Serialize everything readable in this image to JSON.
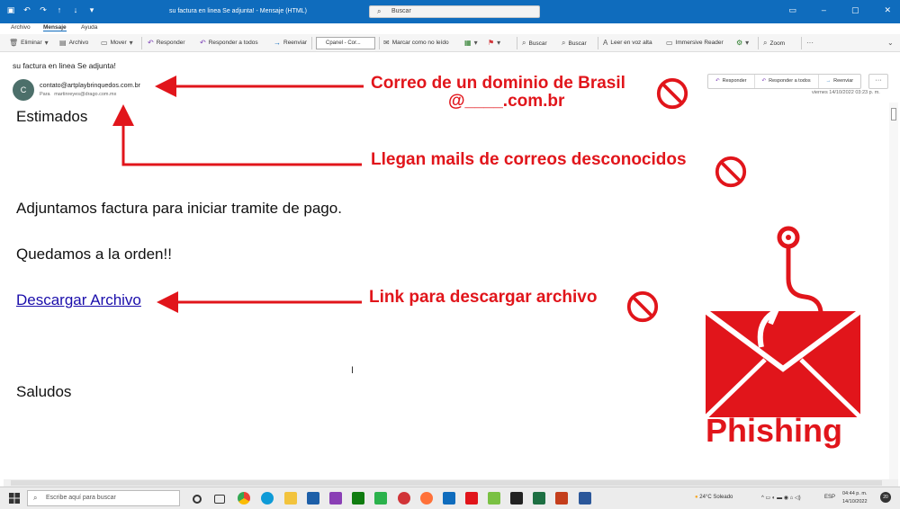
{
  "window": {
    "title": "su factura en linea Se adjunta! - Mensaje (HTML)",
    "search_placeholder": "Buscar"
  },
  "menu": {
    "items": [
      "Archivo",
      "Mensaje",
      "Ayuda"
    ],
    "active": "Mensaje"
  },
  "ribbon": {
    "eliminar": "Eliminar",
    "archivo": "Archivo",
    "mover": "Mover",
    "responder": "Responder",
    "responder_todos": "Responder a todos",
    "reenviar": "Reenviar",
    "cpanel": "Cpanel - Cor...",
    "marcar": "Marcar como no leído",
    "buscar1": "Buscar",
    "buscar2": "Buscar",
    "leer": "Leer en voz alta",
    "immersive": "Immersive Reader",
    "zoom": "Zoom"
  },
  "message": {
    "subject": "su factura en linea Se adjunta!",
    "avatar_initial": "C",
    "from": "contato@artplaybrinquedos.com.br",
    "to_label": "Para",
    "to": "martinreyes@drago.com.mx",
    "date": "viernes 14/10/2022 03:23 p. m.",
    "actions": {
      "responder": "Responder",
      "responder_todos": "Responder a todos",
      "reenviar": "Reenviar",
      "more": "···"
    },
    "body": {
      "greeting": "Estimados",
      "line1": "Adjuntamos factura para iniciar tramite de pago.",
      "line2": "Quedamos a la orden!!",
      "link": "Descargar Archivo",
      "closing": "Saludos"
    }
  },
  "annotations": {
    "a1_line1": "Correo de un dominio de Brasil",
    "a1_line2": "@____.com.br",
    "a2": "Llegan mails de correos desconocidos",
    "a3": "Link para descargar archivo",
    "phishing": "Phishing",
    "accent_color": "#e1151b"
  },
  "taskbar": {
    "search_placeholder": "Escribe aquí para buscar",
    "weather": "24°C  Soleado",
    "lang": "ESP",
    "time": "04:44 p. m.",
    "date": "14/10/2022",
    "badge": "20"
  }
}
